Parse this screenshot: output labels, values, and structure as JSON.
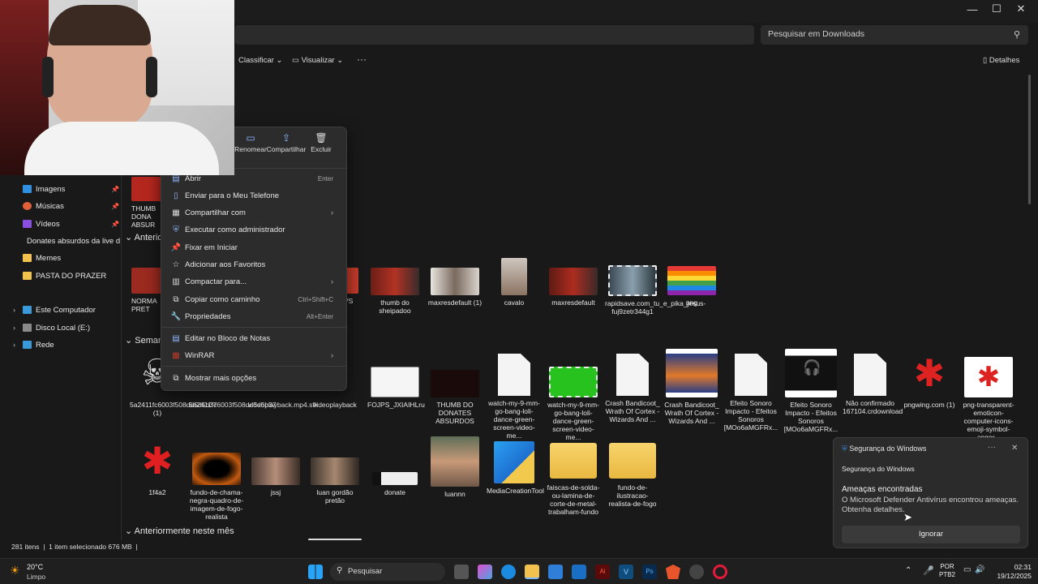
{
  "window": {
    "minimize": "—",
    "maximize": "☐",
    "close": "✕"
  },
  "search": {
    "placeholder": "Pesquisar em Downloads",
    "icon": "search-icon"
  },
  "commandbar": {
    "sort": "Classificar",
    "view": "Visualizar",
    "more": "···",
    "details": "Detalhes"
  },
  "sidebar": {
    "items": [
      {
        "label": "Imagens",
        "icon": "pictures-icon",
        "color": "#2f8fe0",
        "pinned": true
      },
      {
        "label": "Músicas",
        "icon": "music-icon",
        "color": "#e0603a",
        "pinned": true
      },
      {
        "label": "Vídeos",
        "icon": "videos-icon",
        "color": "#8a4fe0",
        "pinned": true
      },
      {
        "label": "Donates absurdos da live do L",
        "icon": "folder-icon",
        "color": "#f2c14e"
      },
      {
        "label": "Memes",
        "icon": "folder-icon",
        "color": "#f2c14e"
      },
      {
        "label": "PASTA DO PRAZER",
        "icon": "folder-icon",
        "color": "#f2c14e"
      },
      {
        "label": "Este Computador",
        "icon": "computer-icon",
        "color": "#3a9ad9"
      },
      {
        "label": "Disco Local (E:)",
        "icon": "drive-icon",
        "color": "#8a8a8a"
      },
      {
        "label": "Rede",
        "icon": "network-icon",
        "color": "#3a9ad9"
      }
    ]
  },
  "groups": {
    "g1": "Anterior",
    "g2": "Semana",
    "g3": "Anteriormente neste mês"
  },
  "files_row0": [
    {
      "label": "THUMB DONA ABSUR"
    }
  ],
  "files_row1": [
    {
      "label": "NORMA PRET"
    },
    {
      "label": "VS"
    },
    {
      "label": "thumb do sheipadoo"
    },
    {
      "label": "maxresdefault (1)"
    },
    {
      "label": "cavalo"
    },
    {
      "label": "maxresdefault"
    },
    {
      "label": "rapidsave.com_tu_e_pika_jesus-fuj9zetr344g1"
    },
    {
      "label": "png"
    }
  ],
  "files_row2": [
    {
      "label": "5a2411fc6003f508dd5d5b37 (1)"
    },
    {
      "label": "5a2411fc6003f508dd5d5b37"
    },
    {
      "label": "videoplayback.mp4.sfk"
    },
    {
      "label": "videoplayback"
    },
    {
      "label": "FOJPS_JXIAIHLru"
    },
    {
      "label": "THUMB DO DONATES ABSURDOS"
    },
    {
      "label": "watch-my-9-mm-go-bang-loli-dance-green-screen-video-me..."
    },
    {
      "label": "watch-my-9-mm-go-bang-loli-dance-green-screen-video-me..."
    },
    {
      "label": "Crash Bandicoot_ Wrath Of Cortex - Wizards And ..."
    },
    {
      "label": "Crash Bandicoot_ Wrath Of Cortex - Wizards And ..."
    },
    {
      "label": "Efeito Sonoro Impacto - Efeitos Sonoros [MOo6aMGFRx..."
    },
    {
      "label": "Efeito Sonoro Impacto - Efeitos Sonoros [MOo6aMGFRx..."
    },
    {
      "label": "Não confirmado 167104.crdownload"
    },
    {
      "label": "pngwing.com (1)"
    },
    {
      "label": "png-transparent-emoticon-computer-icons-emoji-symbol-anger..."
    }
  ],
  "files_row3": [
    {
      "label": "1f4a2"
    },
    {
      "label": "fundo-de-chama-negra-quadro-de-imagem-de-fogo-realista"
    },
    {
      "label": "jssj"
    },
    {
      "label": "luan gordão pretão"
    },
    {
      "label": "donate"
    },
    {
      "label": "luannn"
    },
    {
      "label": "MediaCreationTool"
    },
    {
      "label": "faiscas-de-solda-ou-lamina-de-corte-de-metal-trabalham-fundo"
    },
    {
      "label": "fundo-de-ilustracao-realista-de-fogo"
    }
  ],
  "context_menu": {
    "top": [
      {
        "label": "Renomear",
        "icon": "rename-icon"
      },
      {
        "label": "Compartilhar",
        "icon": "share-icon"
      },
      {
        "label": "Excluir",
        "icon": "delete-icon"
      }
    ],
    "items": [
      {
        "label": "Abrir",
        "shortcut": "Enter"
      },
      {
        "label": "Enviar para o Meu Telefone"
      },
      {
        "label": "Compartilhar com",
        "submenu": true
      },
      {
        "label": "Executar como administrador"
      },
      {
        "label": "Fixar em Iniciar"
      },
      {
        "label": "Adicionar aos Favoritos"
      },
      {
        "label": "Compactar para...",
        "submenu": true
      },
      {
        "label": "Copiar como caminho",
        "shortcut": "Ctrl+Shift+C"
      },
      {
        "label": "Propriedades",
        "shortcut": "Alt+Enter"
      },
      {
        "label": "Editar no Bloco de Notas"
      },
      {
        "label": "WinRAR",
        "submenu": true
      },
      {
        "label": "Mostrar mais opções"
      }
    ]
  },
  "toast": {
    "app": "Segurança do Windows",
    "subtitle": "Segurança do Windows",
    "heading": "Ameaças encontradas",
    "body": "O Microsoft Defender Antivírus encontrou ameaças. Obtenha detalhes.",
    "more": "···",
    "close": "✕",
    "button": "Ignorar"
  },
  "status": {
    "count": "281 itens",
    "selected": "1 item selecionado  676 MB"
  },
  "taskbar": {
    "weather_temp": "20°C",
    "weather_desc": "Limpo",
    "search": "Pesquisar",
    "lang1": "POR",
    "lang2": "PTB2",
    "time": "02:31",
    "date": "19/12/2025"
  }
}
